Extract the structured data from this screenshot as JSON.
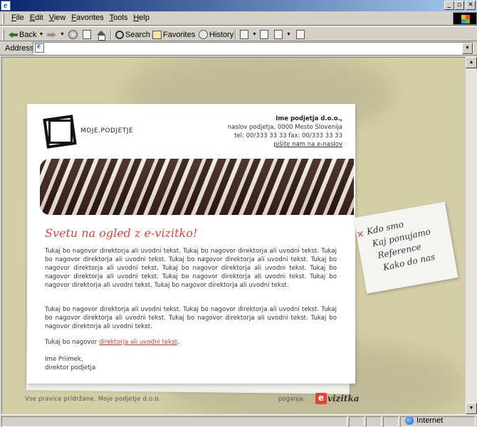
{
  "window": {
    "minimize": "_",
    "maximize": "▫",
    "close": "✕"
  },
  "menu": [
    "File",
    "Edit",
    "View",
    "Favorites",
    "Tools",
    "Help"
  ],
  "toolbar": {
    "back": "Back",
    "search": "Search",
    "favorites": "Favorites",
    "history": "History"
  },
  "address": {
    "label": "Address",
    "value": ""
  },
  "page": {
    "logo_text": "MOJE.PODJETJE",
    "contact": {
      "company": "Ime podjetja d.o.o.,",
      "address": "naslov podjetja, 0000 Mesto Slovenija",
      "phones": "tel: 00/333 33 33 fax: 00/333 33 33",
      "email_link": "pišite nam na e-naslov"
    },
    "headline": "Svetu na ogled z e-vizitko!",
    "para1": "Tukaj bo nagovor direktorja ali uvodni tekst. Tukaj bo nagovor direktorja ali uvodni tekst. Tukaj bo nagovor direktorja ali uvodni tekst. Tukaj bo nagovor direktorja ali uvodni tekst. Tukaj bo nagovor direktorja ali uvodni tekst. Tukaj bo nagovor direktorja ali uvodni tekst. Tukaj bo nagovor direktorja ali uvodni tekst. Tukaj bo nagovor direktorja ali uvodni tekst. Tukaj bo nagovor direktorja ali uvodni tekst. Tukaj bo nagovor direktorja ali uvodni tekst.",
    "para2": "Tukaj bo nagovor direktorja ali uvodni tekst. Tukaj bo nagovor direktorja ali uvodni tekst. Tukaj bo nagovor direktorja ali uvodni tekst. Tukaj bo nagovor direktorja ali uvodni tekst. Tukaj bo nagovor direktorja ali uvodni tekst.",
    "para3_prefix": "Tukaj bo nagovor ",
    "para3_link": "direktorja ali uvodni tekst",
    "para3_suffix": ".",
    "sig_name": "Ime Priimek,",
    "sig_title": "direktor podjetja",
    "nav": [
      "Kdo smo",
      "Kaj ponujamo",
      "Reference",
      "Kako do nas"
    ],
    "footer": "Vse pravice pridržane. Moje podjetje d.o.o.",
    "powered_by": "poganja:",
    "brand": "vizitka",
    "brand_e": "e"
  },
  "status": {
    "zone": "Internet"
  },
  "colors": {
    "accent": "#e0443a",
    "page_bg": "#d4cea6"
  }
}
